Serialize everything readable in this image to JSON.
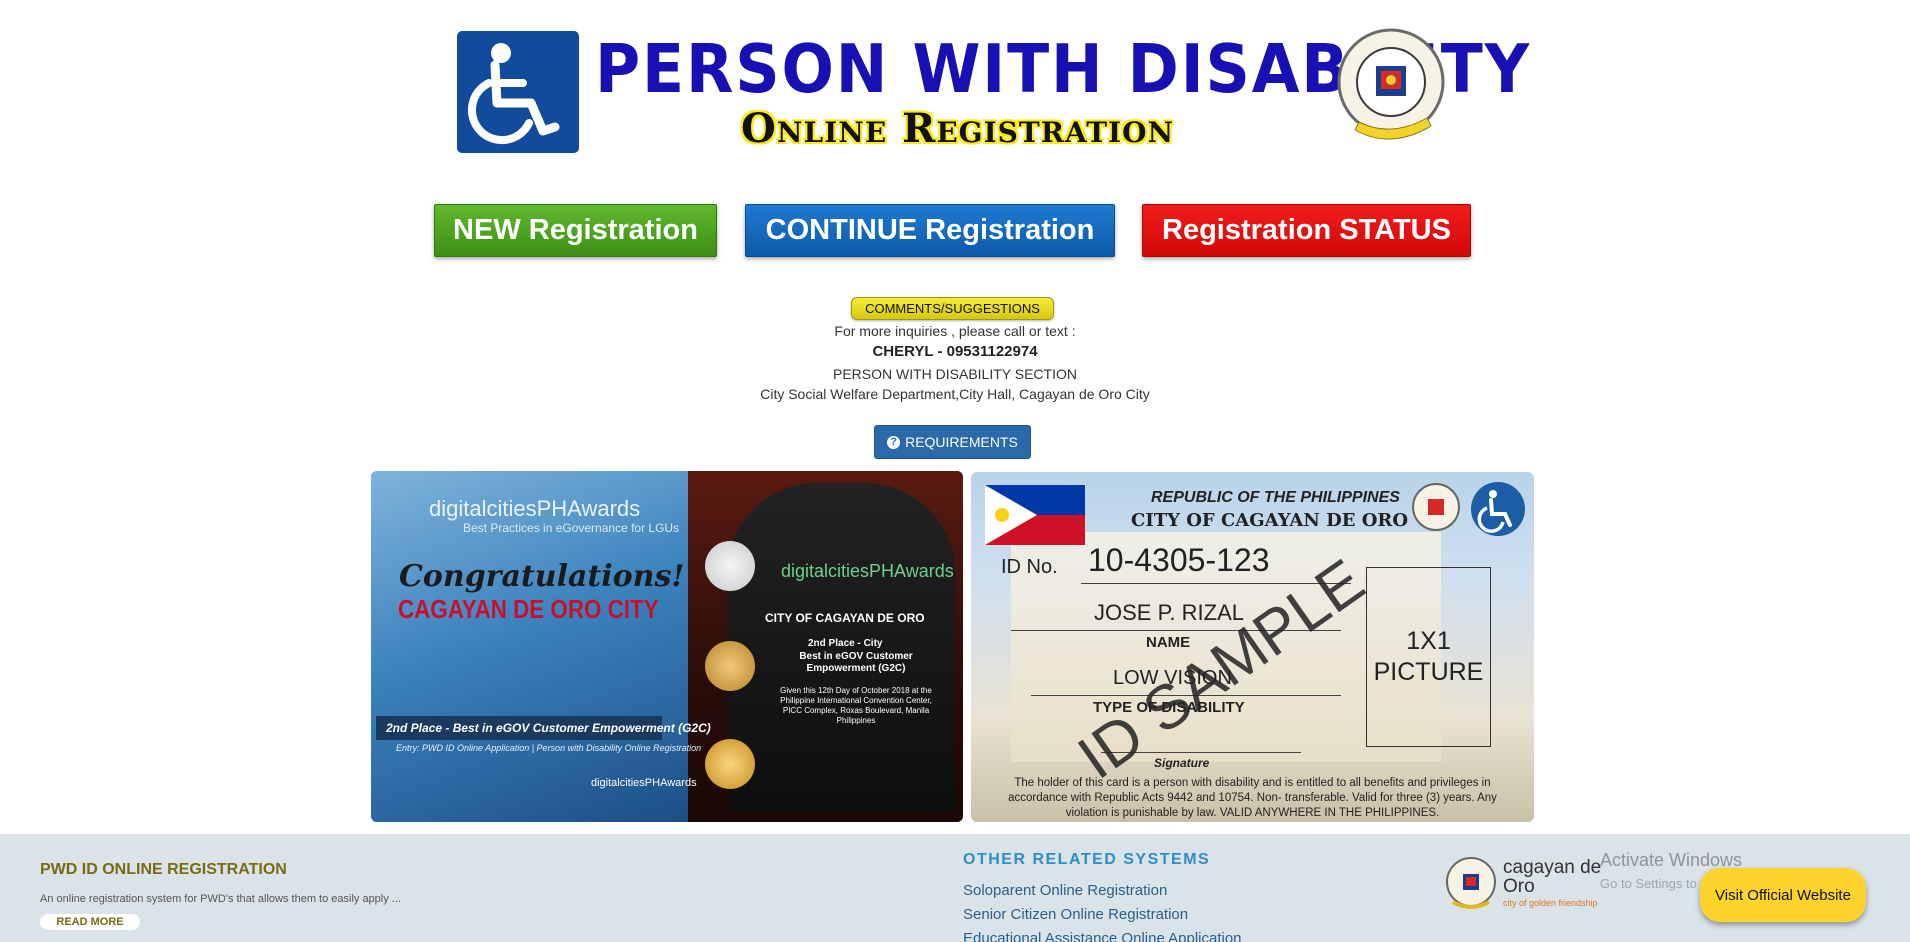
{
  "header": {
    "title": "PERSON WITH DISABILITY",
    "subtitle": "Online Registration",
    "seal_text": "CITY OF CAGAYAN DE ORO",
    "seal_country": "PHILIPPINES",
    "seal_motto": "City of Golden Friendship"
  },
  "actions": {
    "new_label": "NEW Registration",
    "continue_label": "CONTINUE Registration",
    "status_label": "Registration STATUS"
  },
  "info": {
    "comments_label": "COMMENTS/SUGGESTIONS",
    "inquiries": "For more inquiries , please call or text :",
    "contact": "CHERYL - 09531122974",
    "section": "PERSON WITH DISABILITY SECTION",
    "address": "City Social Welfare Department,City Hall, Cagayan de Oro City",
    "requirements_label": "REQUIREMENTS",
    "requirements_icon": "question-circle-icon"
  },
  "award": {
    "brand": "digitalcitiesPHAwards",
    "brand_sub": "Best Practices in eGovernance for LGUs",
    "congrats": "Congratulations!",
    "city": "CAGAYAN DE ORO CITY",
    "place": "2nd Place - Best in eGOV Customer Empowerment (G2C)",
    "entry": "Entry: PWD ID Online Application | Person with Disability Online Registration",
    "footer": "digitalcitiesPHAwards",
    "plaque_city": "CITY OF CAGAYAN DE ORO",
    "plaque_place": "2nd Place - City",
    "plaque_desc": "Best in eGOV Customer Empowerment (G2C)",
    "plaque_given": "Given this 12th Day of October 2018 at the Philippine International Convention Center, PICC Complex, Roxas Boulevard, Manila Philippines"
  },
  "idcard": {
    "republic": "REPUBLIC OF THE PHILIPPINES",
    "city": "CITY OF CAGAYAN DE ORO",
    "id_label": "ID No.",
    "id_number": "10-4305-123",
    "name": "JOSE P. RIZAL",
    "name_caption": "NAME",
    "disability": "LOW VISION",
    "disability_caption": "TYPE OF DISABILITY",
    "photo": "1X1 PICTURE",
    "signature_caption": "Signature",
    "watermark": "ID SAMPLE",
    "note": "The holder of this card is a person with disability and is entitled to all benefits and privileges in accordance with Republic Acts 9442 and 10754. Non- transferable. Valid for three (3) years. Any violation is punishable by law. VALID ANYWHERE IN THE PHILIPPINES."
  },
  "footer": {
    "title": "PWD ID ONLINE REGISTRATION",
    "description": "An online registration system for PWD's that allows them to easily apply ...",
    "read_more": "READ MORE",
    "other_title": "OTHER RELATED SYSTEMS",
    "links": [
      "Soloparent Online Registration",
      "Senior Citizen Online Registration",
      "Educational Assistance Online Application"
    ],
    "cdo_brand": "cagayan de Oro",
    "cdo_tagline": "city of golden friendship",
    "activate_title": "Activate Windows",
    "activate_sub": "Go to Settings to activate Windows.",
    "visit_label": "Visit Official Website"
  },
  "colors": {
    "title_blue": "#1710b3",
    "new_green": "#3d8f14",
    "continue_blue": "#0c5aa8",
    "status_red": "#d00808",
    "visit_yellow": "#fed42c"
  }
}
